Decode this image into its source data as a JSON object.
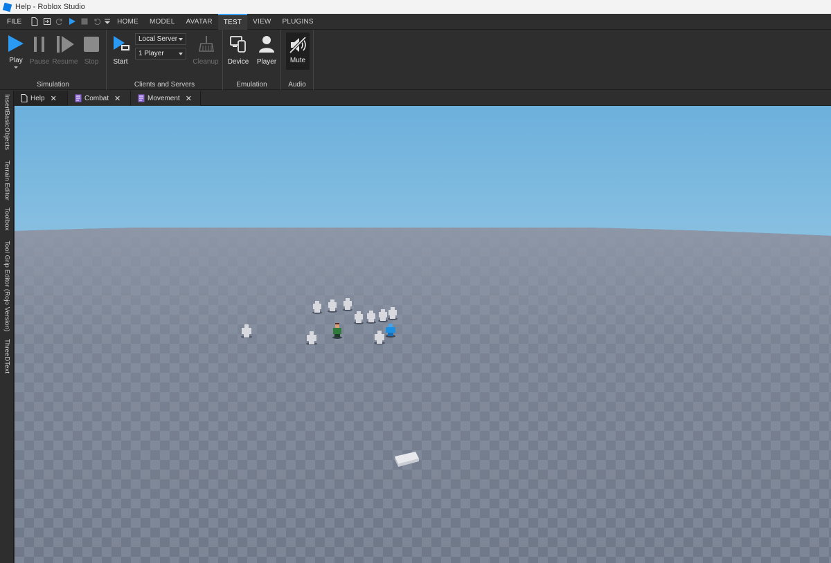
{
  "window": {
    "title": "Help - Roblox Studio"
  },
  "menubar": {
    "file_label": "FILE",
    "tabs": [
      {
        "label": "HOME",
        "active": false
      },
      {
        "label": "MODEL",
        "active": false
      },
      {
        "label": "AVATAR",
        "active": false
      },
      {
        "label": "TEST",
        "active": true
      },
      {
        "label": "VIEW",
        "active": false
      },
      {
        "label": "PLUGINS",
        "active": false
      }
    ]
  },
  "ribbon": {
    "simulation": {
      "label": "Simulation",
      "play": "Play",
      "pause": "Pause",
      "resume": "Resume",
      "stop": "Stop"
    },
    "clients": {
      "label": "Clients and Servers",
      "start": "Start",
      "server_mode": "Local Server",
      "player_count": "1 Player",
      "cleanup": "Cleanup"
    },
    "emulation": {
      "label": "Emulation",
      "device": "Device",
      "player": "Player"
    },
    "audio": {
      "label": "Audio",
      "mute": "Mute"
    }
  },
  "sidedock": {
    "tabs": [
      "InsertBasicObjects",
      "Terrain Editor",
      "Toolbox",
      "Tool Grip Editor (Rojo Version)",
      "ThreeDText"
    ]
  },
  "doctabs": [
    {
      "label": "Help",
      "type": "help",
      "active": true
    },
    {
      "label": "Combat",
      "type": "script",
      "active": false
    },
    {
      "label": "Movement",
      "type": "script",
      "active": false
    }
  ],
  "colors": {
    "accent": "#3aa0ff",
    "play_blue": "#2b9af3",
    "script_purple": "#8a63d2"
  }
}
